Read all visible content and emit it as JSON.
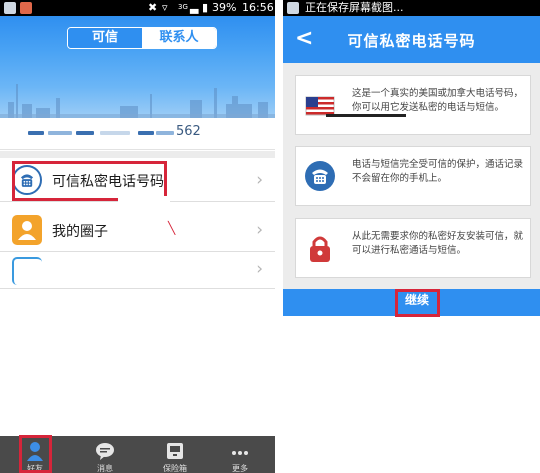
{
  "left": {
    "status": {
      "battery": "39%",
      "time": "16:56",
      "network": "3G"
    },
    "tabs": {
      "active": "可信",
      "inactive": "联系人"
    },
    "profile": {
      "number_suffix": "562"
    },
    "rows": [
      {
        "label": "可信私密电话号码"
      },
      {
        "label": "我的圈子"
      },
      {
        "label": ""
      }
    ],
    "tabbar": [
      {
        "label": "好友",
        "icon": "person-icon"
      },
      {
        "label": "消息",
        "icon": "chat-icon"
      },
      {
        "label": "保险箱",
        "icon": "safe-icon"
      },
      {
        "label": "更多",
        "icon": "more-icon"
      }
    ]
  },
  "right": {
    "status": {
      "notice": "正在保存屏幕截图..."
    },
    "header": {
      "title": "可信私密电话号码",
      "back": "<"
    },
    "cards": [
      {
        "text": "这是一个真实的美国或加拿大电话号码，你可以用它发送私密的电话与短信。",
        "icon": "us-flag-icon"
      },
      {
        "text": "电话与短信完全受可信的保护，通话记录不会留在你的手机上。",
        "icon": "phone-icon"
      },
      {
        "text": "从此无需要求你的私密好友安装可信，就可以进行私密通话与短信。",
        "icon": "lock-icon"
      }
    ],
    "continue_label": "继续"
  },
  "colors": {
    "accent": "#2f8ff0",
    "highlight": "#d6253a",
    "tabbar": "#4a4a4a"
  }
}
